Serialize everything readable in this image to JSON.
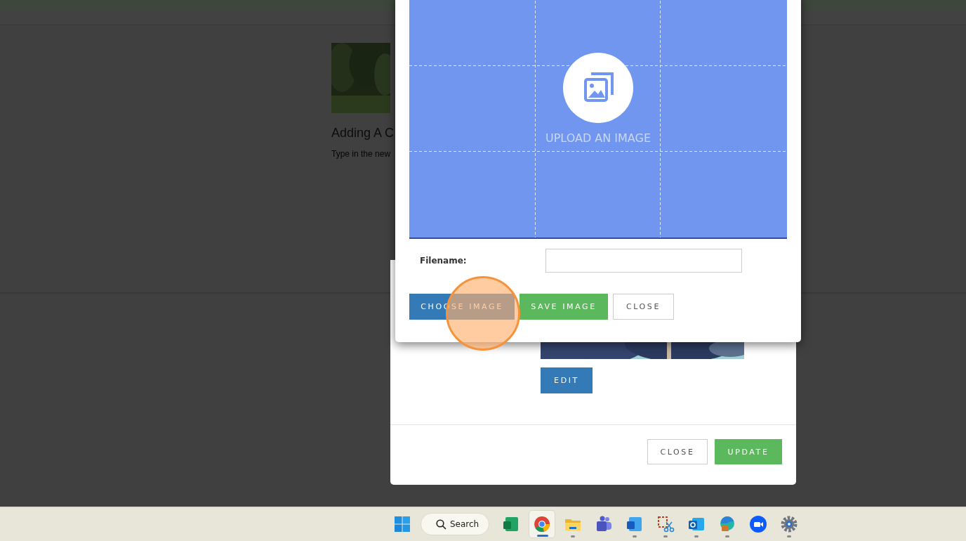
{
  "background_page": {
    "article": {
      "kind": "picture",
      "title": "Adding A C",
      "text": "Type in the new"
    }
  },
  "edit_dialog": {
    "edit_button": {
      "label": "EDIT",
      "kind": "primary"
    },
    "footer_buttons": [
      {
        "label": "CLOSE",
        "kind": "default"
      },
      {
        "label": "UPDATE",
        "kind": "success"
      }
    ]
  },
  "image_dialog": {
    "upload_label": "UPLOAD AN IMAGE",
    "filename_label": "Filename:",
    "buttons": [
      {
        "label": "CHOOSE IMAGE",
        "kind": "primary"
      },
      {
        "label": "SAVE IMAGE",
        "kind": "success"
      },
      {
        "label": "CLOSE",
        "kind": "default"
      }
    ]
  },
  "taskbar": {
    "search": "Search",
    "apps": [
      {
        "kind": "excel",
        "running": false,
        "selected": false
      },
      {
        "kind": "chrome",
        "running": true,
        "selected": true
      },
      {
        "kind": "folder",
        "running": true,
        "selected": false
      },
      {
        "kind": "teams",
        "running": false,
        "selected": false
      },
      {
        "kind": "word",
        "running": true,
        "selected": false
      },
      {
        "kind": "snip",
        "running": true,
        "selected": false
      },
      {
        "kind": "outlook",
        "running": true,
        "selected": false
      },
      {
        "kind": "edge",
        "running": true,
        "selected": false
      },
      {
        "kind": "zoom",
        "running": false,
        "selected": false
      },
      {
        "kind": "settings",
        "running": true,
        "selected": false
      }
    ]
  }
}
